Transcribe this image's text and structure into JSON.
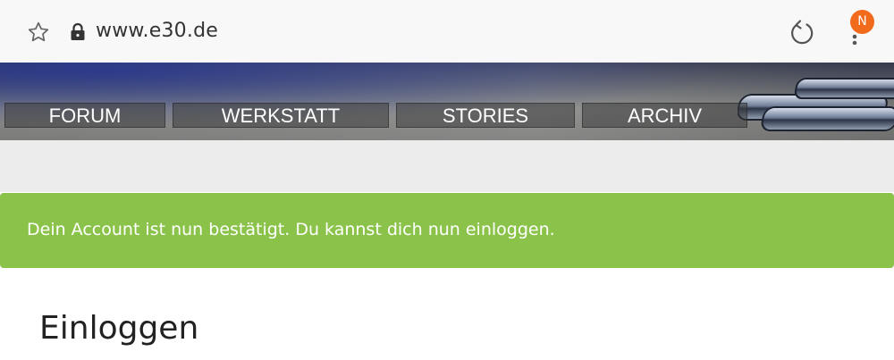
{
  "browser": {
    "url": "www.e30.de",
    "badge_letter": "N"
  },
  "nav": {
    "items": [
      {
        "label": "FORUM"
      },
      {
        "label": "WERKSTATT"
      },
      {
        "label": "STORIES"
      },
      {
        "label": "ARCHIV"
      }
    ]
  },
  "alert": {
    "message": "Dein Account ist nun bestätigt. Du kannst dich nun einloggen.",
    "color": "#8bc34a"
  },
  "main": {
    "title": "Einloggen"
  }
}
